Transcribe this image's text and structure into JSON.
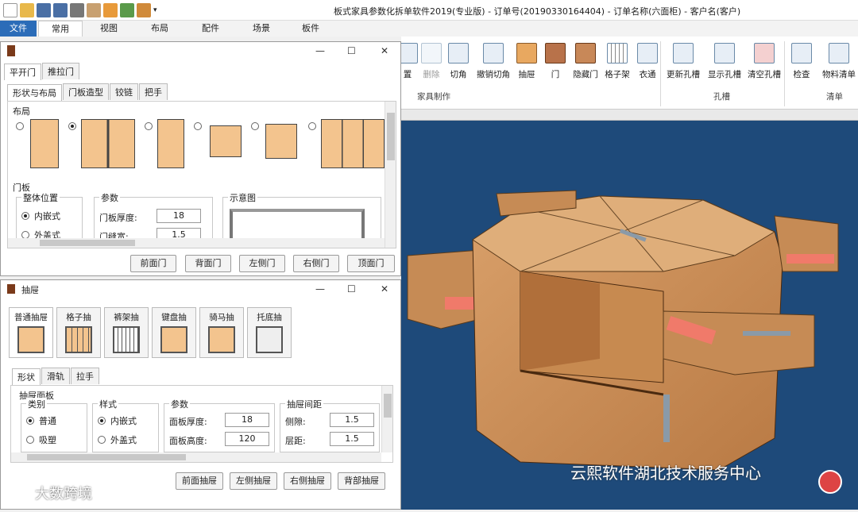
{
  "window": {
    "title": "板式家具参数化拆单软件2019(专业版) - 订单号(20190330164404) - 订单名称(六面柜) - 客户名(客户)"
  },
  "ribbon_tabs": [
    "文件",
    "常用",
    "视图",
    "布局",
    "配件",
    "场景",
    "板件"
  ],
  "ribbon": {
    "buttons": [
      "置",
      "删除",
      "切角",
      "撤销切角",
      "抽屉",
      "门",
      "隐藏门",
      "格子架",
      "衣通",
      "更新孔槽",
      "显示孔槽",
      "清空孔槽",
      "检查",
      "物料清单"
    ],
    "groups": [
      "家具制作",
      "孔槽",
      "清单"
    ]
  },
  "door_dialog": {
    "top_tabs": [
      "平开门",
      "推拉门"
    ],
    "tabs": [
      "形状与布局",
      "门板造型",
      "铰链",
      "把手"
    ],
    "layout_title": "布局",
    "door_panel_title": "门板",
    "position_group": {
      "title": "整体位置",
      "options": [
        "内嵌式",
        "外盖式"
      ]
    },
    "params_group": {
      "title": "参数",
      "fields": [
        {
          "label": "门板厚度:",
          "value": "18"
        },
        {
          "label": "门缝宽:",
          "value": "1.5"
        }
      ]
    },
    "diagram_title": "示意图",
    "buttons": [
      "前面门",
      "背面门",
      "左侧门",
      "右侧门",
      "顶面门"
    ]
  },
  "drawer_dialog": {
    "title": "抽屉",
    "types": [
      "普通抽屉",
      "格子抽",
      "裤架抽",
      "键盘抽",
      "骑马抽",
      "托底抽"
    ],
    "tabs": [
      "形状",
      "滑轨",
      "拉手"
    ],
    "panel_title": "抽屉面板",
    "category_group": {
      "title": "类别",
      "options": [
        "普通",
        "吸塑"
      ]
    },
    "style_group": {
      "title": "样式",
      "options": [
        "内嵌式",
        "外盖式"
      ]
    },
    "params_group": {
      "title": "参数",
      "fields": [
        {
          "label": "面板厚度:",
          "value": "18"
        },
        {
          "label": "面板高度:",
          "value": "120"
        }
      ]
    },
    "gap_group": {
      "title": "抽屉间距",
      "fields": [
        {
          "label": "侧隙:",
          "value": "1.5"
        },
        {
          "label": "层距:",
          "value": "1.5"
        }
      ]
    },
    "buttons": [
      "前面抽屉",
      "左侧抽屉",
      "右侧抽屉",
      "背部抽屉"
    ]
  },
  "watermarks": {
    "left": "大数跨境",
    "right": "云熙软件湖北技术服务中心"
  }
}
